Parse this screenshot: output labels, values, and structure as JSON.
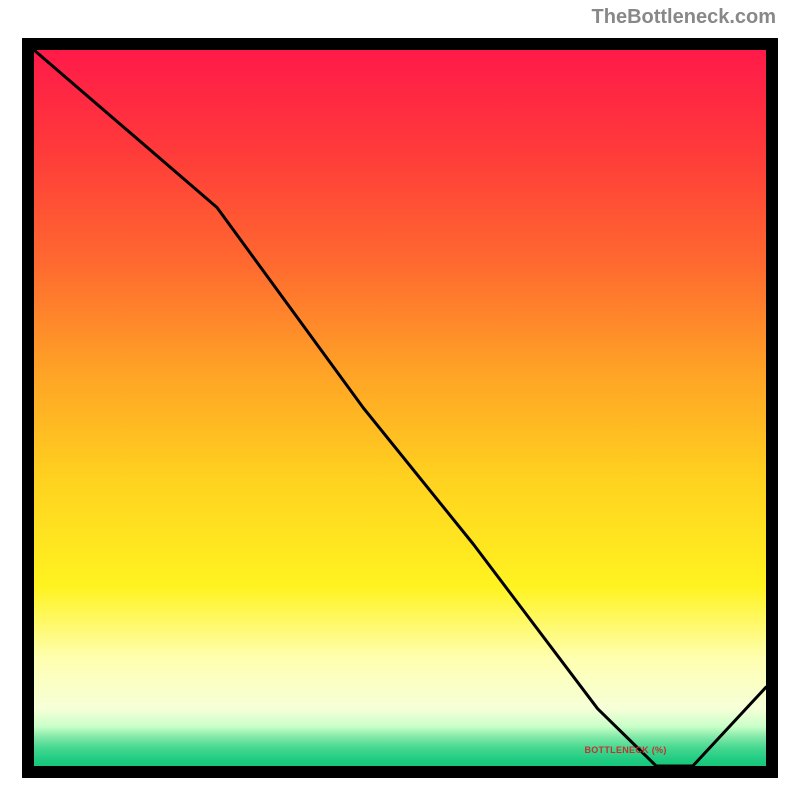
{
  "attribution": "TheBottleneck.com",
  "chart_data": {
    "type": "line",
    "x": [
      0.0,
      0.25,
      0.45,
      0.6,
      0.77,
      0.85,
      0.9,
      1.0
    ],
    "values": [
      1.0,
      0.78,
      0.5,
      0.31,
      0.08,
      0.0,
      0.0,
      0.11
    ],
    "min_x_fraction_range": [
      0.78,
      0.9
    ],
    "series_name": "BOTTLENECK (%)",
    "title": "",
    "xlabel": "",
    "ylabel": "",
    "xlim": [
      0,
      1
    ],
    "ylim": [
      0,
      1
    ],
    "gradient_stops": [
      {
        "offset": 0.0,
        "color": "#ff1a4a"
      },
      {
        "offset": 0.14,
        "color": "#ff3a3a"
      },
      {
        "offset": 0.3,
        "color": "#ff6a2f"
      },
      {
        "offset": 0.45,
        "color": "#ffa326"
      },
      {
        "offset": 0.6,
        "color": "#ffd21f"
      },
      {
        "offset": 0.75,
        "color": "#fff320"
      },
      {
        "offset": 0.85,
        "color": "#ffffb0"
      },
      {
        "offset": 0.92,
        "color": "#f6ffd8"
      },
      {
        "offset": 0.945,
        "color": "#c8ffc8"
      },
      {
        "offset": 0.96,
        "color": "#7fe8a6"
      },
      {
        "offset": 0.975,
        "color": "#44d890"
      },
      {
        "offset": 0.99,
        "color": "#22cc82"
      },
      {
        "offset": 1.0,
        "color": "#14c878"
      }
    ]
  },
  "label_position": {
    "left_pct": 75.2,
    "top_pct": 97.0
  }
}
